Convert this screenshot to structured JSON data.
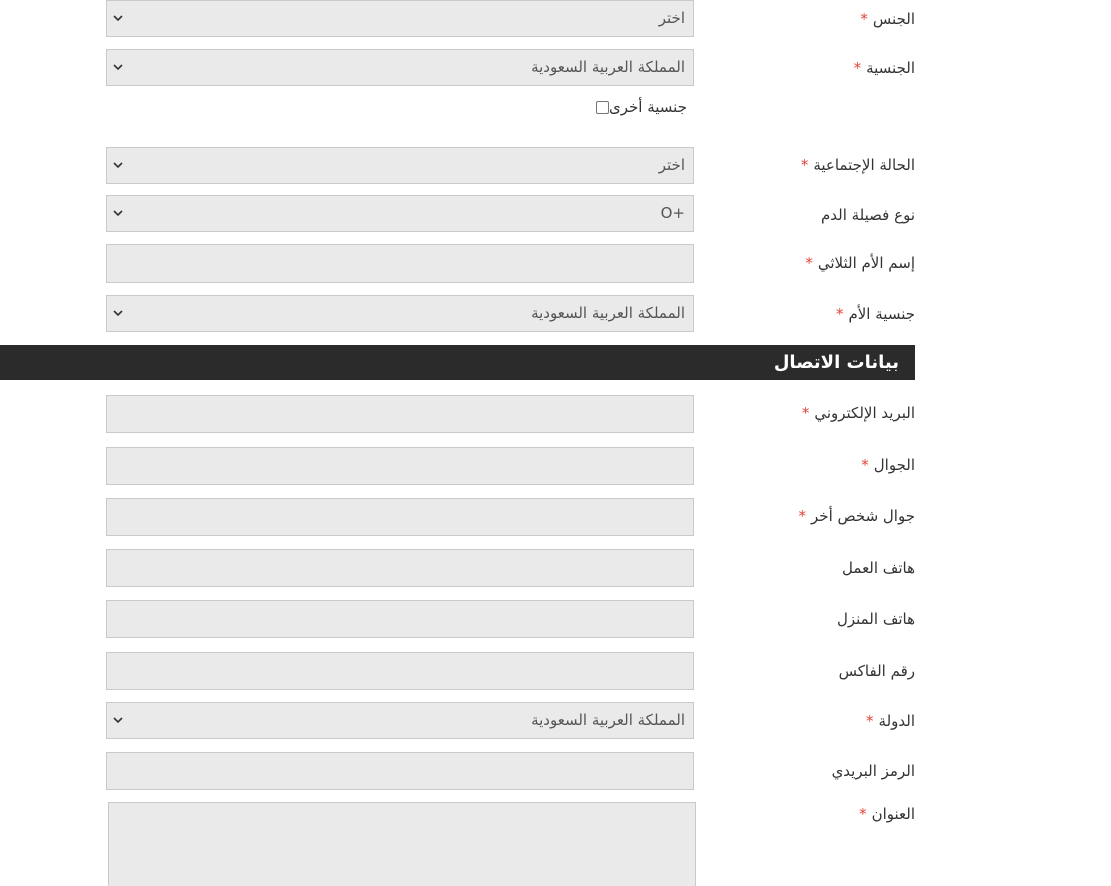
{
  "personal": {
    "gender": {
      "label": "الجنس",
      "required": "*",
      "value": "اختر"
    },
    "nationality": {
      "label": "الجنسية",
      "required": "*",
      "value": "المملكة العربية السعودية"
    },
    "other_nationality": {
      "label": "جنسية أخرى",
      "checked": false
    },
    "marital_status": {
      "label": "الحالة الإجتماعية",
      "required": "*",
      "value": "اختر"
    },
    "blood_type": {
      "label": "نوع فصيلة الدم",
      "value": "O+"
    },
    "mother_name": {
      "label": "إسم الأم الثلاثي",
      "required": "*",
      "value": ""
    },
    "mother_nationality": {
      "label": "جنسية الأم",
      "required": "*",
      "value": "المملكة العربية السعودية"
    }
  },
  "contact": {
    "section_title": "بيانات الاتصال",
    "email": {
      "label": "البريد الإلكتروني",
      "required": "*",
      "value": ""
    },
    "mobile": {
      "label": "الجوال",
      "required": "*",
      "value": ""
    },
    "other_mobile": {
      "label": "جوال شخص أخر",
      "required": "*",
      "value": ""
    },
    "work_phone": {
      "label": "هاتف العمل",
      "value": ""
    },
    "home_phone": {
      "label": "هاتف المنزل",
      "value": ""
    },
    "fax": {
      "label": "رقم الفاكس",
      "value": ""
    },
    "country": {
      "label": "الدولة",
      "required": "*",
      "value": "المملكة العربية السعودية"
    },
    "postal_code": {
      "label": "الرمز البريدي",
      "value": ""
    },
    "address": {
      "label": "العنوان",
      "required": "*",
      "value": ""
    }
  },
  "colors": {
    "required_star": "#e0453a",
    "section_bar": "#2b2b2b",
    "field_bg": "#eaeaea",
    "field_border": "#c9c9c9"
  },
  "icons": {
    "dropdown": "chevron-down-icon"
  }
}
